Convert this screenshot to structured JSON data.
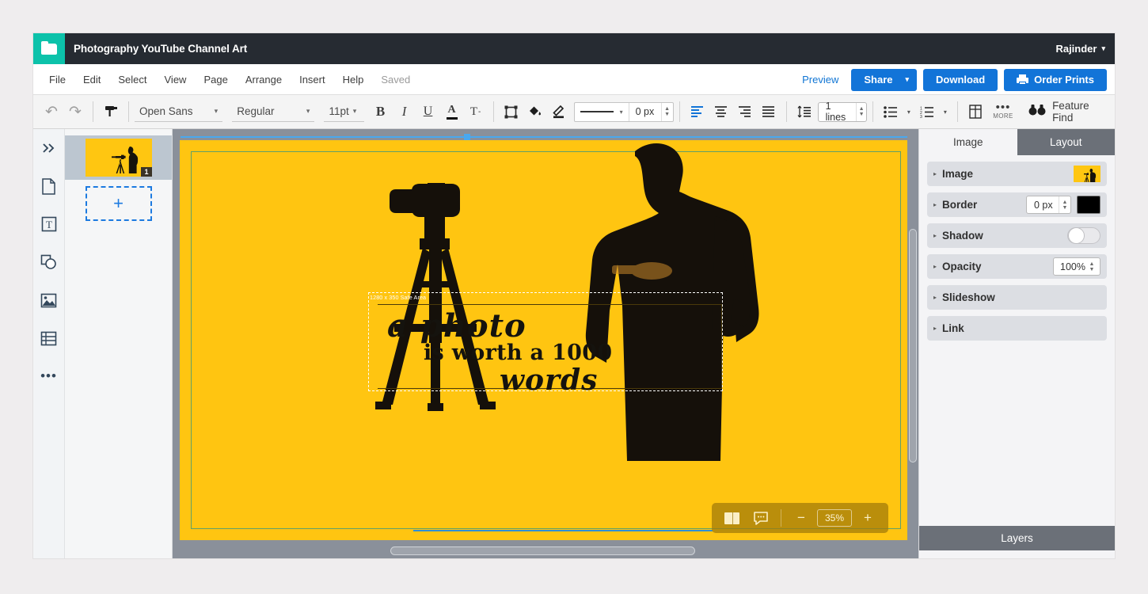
{
  "titlebar": {
    "icon": "folder-icon",
    "document_title": "Photography YouTube Channel Art",
    "user_name": "Rajinder",
    "user_caret": "▾"
  },
  "menubar": {
    "items": [
      {
        "label": "File"
      },
      {
        "label": "Edit"
      },
      {
        "label": "Select"
      },
      {
        "label": "View"
      },
      {
        "label": "Page"
      },
      {
        "label": "Arrange"
      },
      {
        "label": "Insert"
      },
      {
        "label": "Help"
      }
    ],
    "save_status": "Saved",
    "preview_label": "Preview",
    "share_label": "Share",
    "share_caret": "▾",
    "download_label": "Download",
    "order_prints_label": "Order Prints"
  },
  "toolbar": {
    "undo": "↶",
    "redo": "↷",
    "format_painter": "format-painter-icon",
    "font_family": "Open Sans",
    "font_style": "Regular",
    "font_size": "11pt",
    "caret": "▾",
    "bold": "B",
    "italic": "I",
    "underline": "U",
    "text_color": "A",
    "clear_format": "T",
    "stroke_width": "0 px",
    "line_spacing": "1 lines",
    "more_label": "MORE",
    "feature_find_label": "Feature Find"
  },
  "pages": {
    "page_number": "1",
    "add_page_glyph": "+"
  },
  "canvas": {
    "safe_area_label": "1280 x 350 Safe Area",
    "quote_line1": "a photo",
    "quote_line2": "is worth a 1000",
    "quote_line3": "words",
    "background_color": "#ffc511"
  },
  "zoom_control": {
    "spread_view": "spread-view-icon",
    "comments": "comment-icon",
    "minus": "−",
    "zoom_value": "35%",
    "plus": "+"
  },
  "right_panel": {
    "tabs": [
      {
        "label": "Image",
        "active": true
      },
      {
        "label": "Layout",
        "active": false
      }
    ],
    "rows": [
      {
        "label": "Image",
        "triangle": "▸",
        "control": "thumbnail"
      },
      {
        "label": "Border",
        "triangle": "▸",
        "control": "number",
        "value": "0 px",
        "color": "#000000"
      },
      {
        "label": "Shadow",
        "triangle": "▸",
        "control": "toggle",
        "value": "off"
      },
      {
        "label": "Opacity",
        "triangle": "▸",
        "control": "percent",
        "value": "100%"
      },
      {
        "label": "Slideshow",
        "triangle": "▸",
        "control": "none"
      },
      {
        "label": "Link",
        "triangle": "▸",
        "control": "none"
      }
    ],
    "layers_label": "Layers"
  },
  "colors": {
    "titlebar": "#262b32",
    "accent_teal": "#0cc2aa",
    "primary_blue": "#1274d8",
    "canvas_yellow": "#ffc511",
    "panel_gray": "#6b7078"
  }
}
